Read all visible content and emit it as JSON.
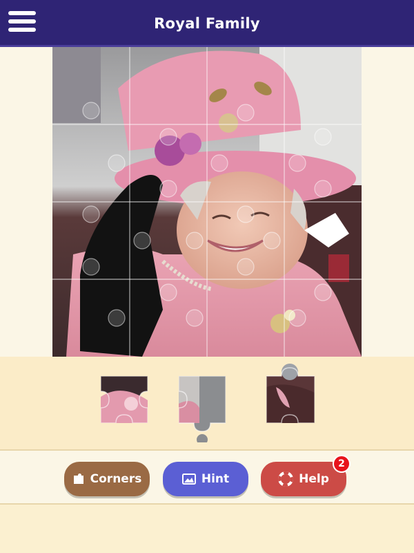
{
  "header": {
    "title": "Royal Family",
    "menu_icon": "hamburger-menu-icon"
  },
  "puzzle": {
    "grid_rows": 4,
    "grid_cols": 4,
    "placed_pieces": 16,
    "tray_pieces": 3
  },
  "toolbar": {
    "corners_label": "Corners",
    "hint_label": "Hint",
    "help_label": "Help",
    "help_badge": "2"
  },
  "colors": {
    "header_bg": "#2f2475",
    "corners_btn": "#9a6a44",
    "hint_btn": "#5b5fd4",
    "help_btn": "#cc4b46",
    "badge": "#e8141c"
  }
}
